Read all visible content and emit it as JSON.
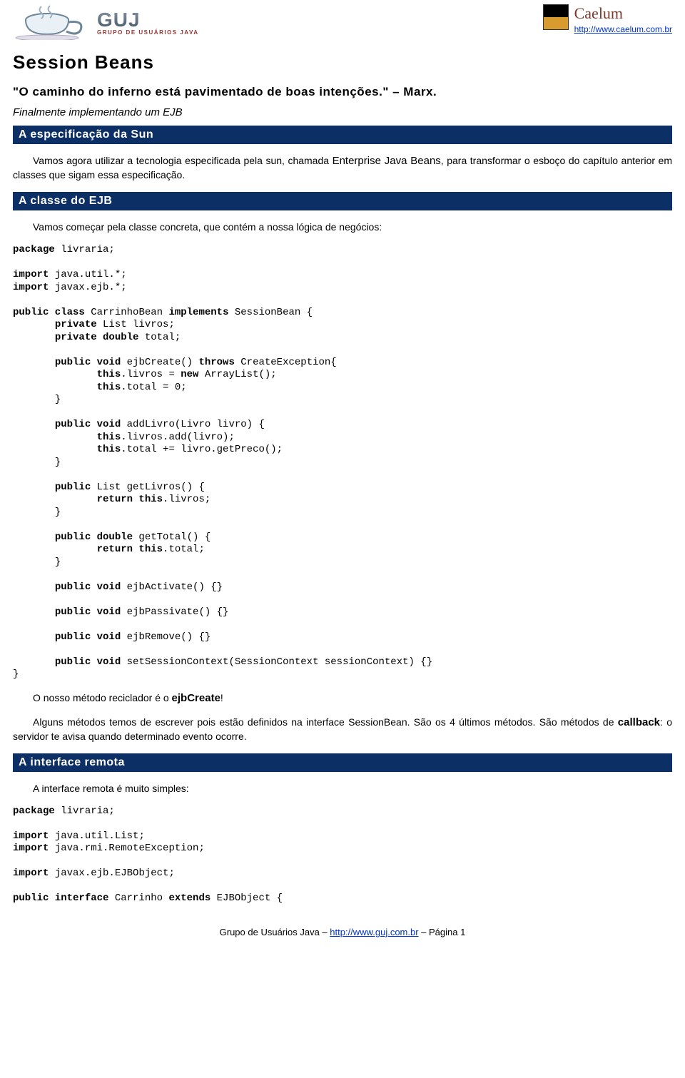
{
  "header": {
    "guj_abbrev": "GUJ",
    "guj_subtitle": "GRUPO DE USUÁRIOS JAVA",
    "caelum_name": "Caelum",
    "caelum_url": "http://www.caelum.com.br"
  },
  "title": "Session Beans",
  "quote_text": "\"O caminho do inferno está pavimentado de boas intenções.\"",
  "quote_attr": " – Marx.",
  "subhead": "Finalmente implementando um EJB",
  "section1": {
    "bar": "A especificação da Sun",
    "p1_a": "Vamos agora utilizar a tecnologia especificada pela sun, chamada ",
    "p1_hl": "Enterprise Java Beans",
    "p1_b": ", para transformar o esboço do capítulo anterior em classes que sigam essa especificação."
  },
  "section2": {
    "bar": "A classe do EJB",
    "p1": "Vamos começar pela classe concreta, que contém a nossa lógica de negócios:",
    "code": "<b>package</b> livraria;\n\n<b>import</b> java.util.*;\n<b>import</b> javax.ejb.*;\n\n<b>public class</b> CarrinhoBean <b>implements</b> SessionBean {\n       <b>private</b> List livros;\n       <b>private double</b> total;\n\n       <b>public void</b> ejbCreate() <b>throws</b> CreateException{\n              <b>this</b>.livros = <b>new</b> ArrayList();\n              <b>this</b>.total = 0;\n       }\n\n       <b>public void</b> addLivro(Livro livro) {\n              <b>this</b>.livros.add(livro);\n              <b>this</b>.total += livro.getPreco();\n       }\n\n       <b>public</b> List getLivros() {\n              <b>return this</b>.livros;\n       }\n\n       <b>public double</b> getTotal() {\n              <b>return this</b>.total;\n       }\n\n       <b>public void</b> ejbActivate() {}\n\n       <b>public void</b> ejbPassivate() {}\n\n       <b>public void</b> ejbRemove() {}\n\n       <b>public void</b> setSessionContext(SessionContext sessionContext) {}\n}",
    "p2_a": "O nosso método reciclador é o ",
    "p2_hl": "ejbCreate",
    "p2_b": "!",
    "p3_a": "Alguns métodos temos de escrever pois estão definidos na interface SessionBean. São os 4 últimos métodos. São métodos de ",
    "p3_hl": "callback",
    "p3_b": ": o servidor te avisa quando determinado evento ocorre."
  },
  "section3": {
    "bar": "A interface remota",
    "p1": "A interface remota é muito simples:",
    "code": "<b>package</b> livraria;\n\n<b>import</b> java.util.List;\n<b>import</b> java.rmi.RemoteException;\n\n<b>import</b> javax.ejb.EJBObject;\n\n<b>public interface</b> Carrinho <b>extends</b> EJBObject {"
  },
  "footer": {
    "text_a": "Grupo de Usuários Java – ",
    "link": "http://www.guj.com.br",
    "text_b": " – Página 1"
  }
}
